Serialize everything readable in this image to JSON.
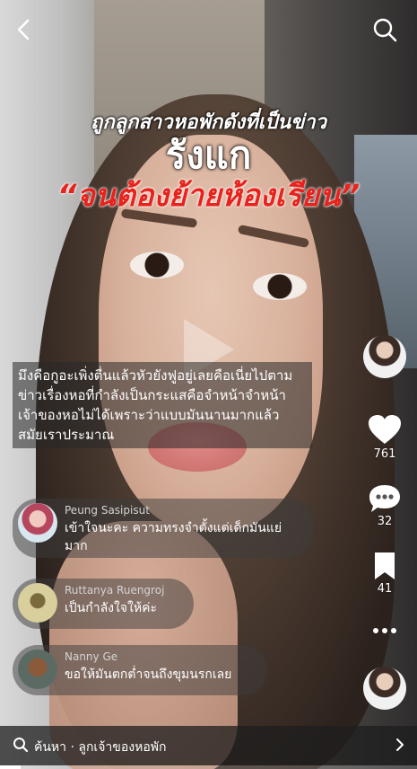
{
  "headline": {
    "line1": "ถูกลูกสาวหอพักดังที่เป็นข่าว",
    "line2": "รังแก",
    "line3": "“จนต้องย้ายห้องเรียน”"
  },
  "caption": {
    "line1": "มึงคือกูอะเพิ่งตื่นแล้วหัวยังฟูอยู่เลยคือเนี่ยไปตาม",
    "line2": "ข่าวเรื่องหอที่กำลังเป็นกระแสคือจำหน้าจำหน้า",
    "line3": "เจ้าของหอไม่ได้เพราะว่าแบบมันนานมากแล้ว",
    "line4": "สมัยเราประมาณ"
  },
  "actions": {
    "likes": "761",
    "comments": "32",
    "saves": "41"
  },
  "comments": [
    {
      "name": "Peung Sasipisut",
      "line1": "เข้าใจนะคะ ความทรงจำตั้งแต่เด็กมันแย่",
      "line2": "มาก"
    },
    {
      "name": "Ruttanya Ruengroj",
      "line1": "เป็นกำลังใจให้ค่ะ",
      "line2": ""
    },
    {
      "name": "Nanny Ge",
      "line1": "ขอให้มันตกต่ำจนถึงขุมนรกเลย",
      "line2": ""
    }
  ],
  "bottom_bar": {
    "label": "ค้นหา · ลูกเจ้าของหอพัก"
  },
  "icons": {
    "back": "chevron-left-icon",
    "search": "search-icon",
    "like": "heart-icon",
    "comment": "speech-bubble-icon",
    "save": "bookmark-icon",
    "more": "more-dots-icon"
  },
  "progress": 0.05
}
